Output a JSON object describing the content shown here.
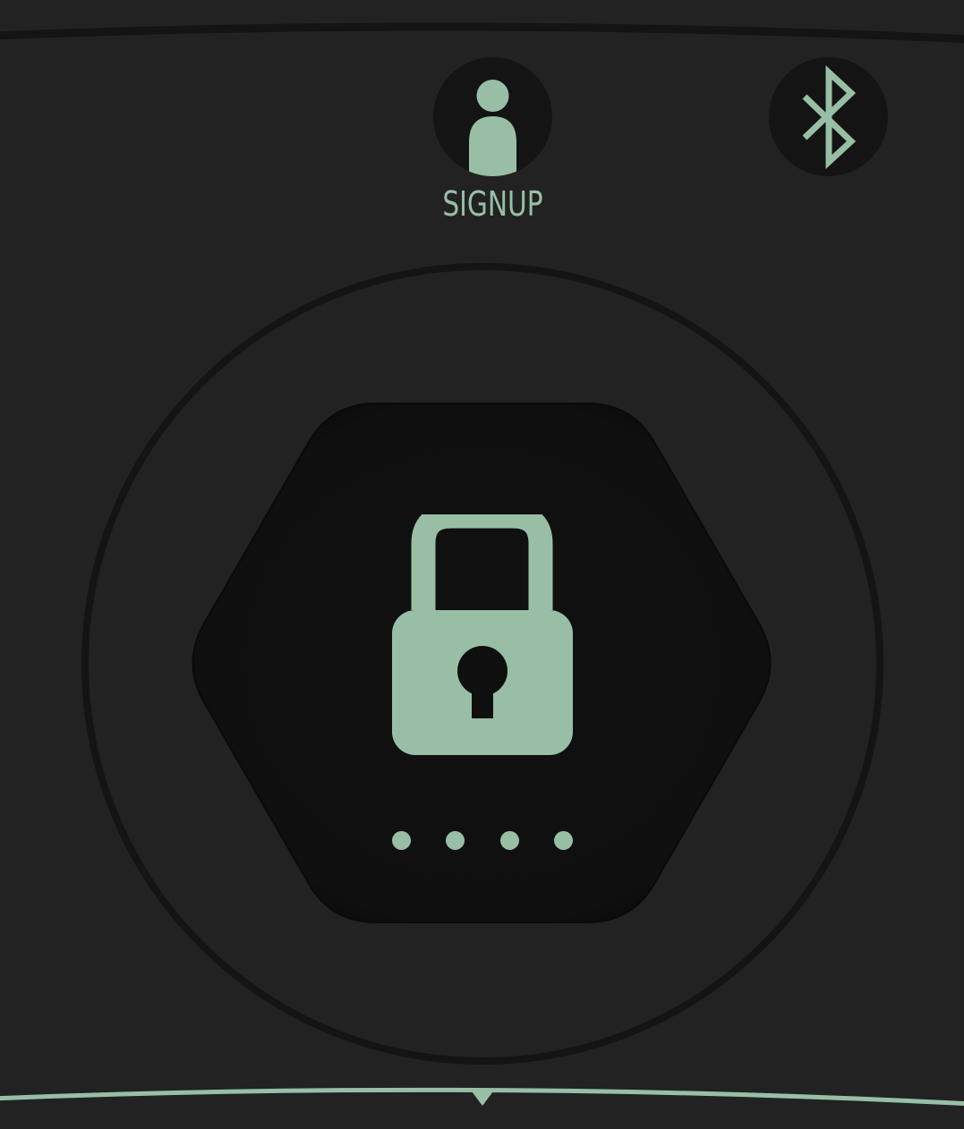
{
  "colors": {
    "background": "#222222",
    "dark": "#141414",
    "pad": "#0f0f0f",
    "accent": "#98bfa5"
  },
  "header": {
    "signup": {
      "label": "SIGNUP",
      "icon": "user-icon"
    },
    "bluetooth": {
      "icon": "bluetooth-icon"
    }
  },
  "lock_pad": {
    "icon": "lock-icon",
    "pin_length": 4
  }
}
